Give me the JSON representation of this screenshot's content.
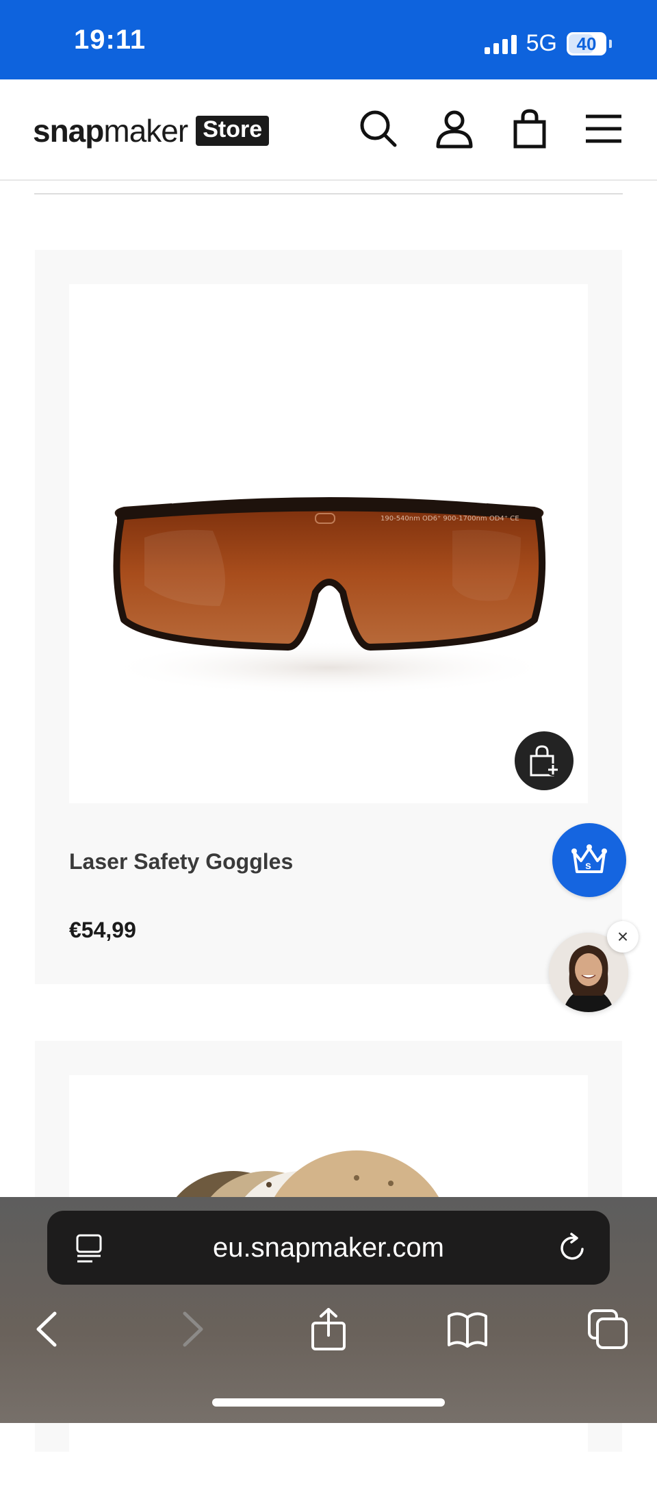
{
  "status_bar": {
    "time": "19:11",
    "network": "5G",
    "battery": "40",
    "icons": [
      "signal-icon",
      "battery-icon"
    ]
  },
  "header": {
    "logo_bold": "snap",
    "logo_light": "maker",
    "logo_store": "Store",
    "icons": [
      "search-icon",
      "account-icon",
      "cart-icon",
      "menu-icon"
    ]
  },
  "product": {
    "title": "Laser Safety Goggles",
    "price": "€54,99",
    "lens_print": "190-540nm OD6⁺ 900-1700nm OD4⁺ CE",
    "quick_add_icon": "add-to-cart-icon"
  },
  "floating": {
    "loyalty_icon": "crown-icon",
    "close_label": "×"
  },
  "safari": {
    "url": "eu.snapmaker.com",
    "icons": [
      "page-menu-icon",
      "reload-icon",
      "back-icon",
      "forward-icon",
      "share-icon",
      "bookmarks-icon",
      "tabs-icon"
    ]
  },
  "colors": {
    "status_bar": "#0e63dd",
    "accent": "#1565e0",
    "card_bg": "#f8f8f8",
    "lens": "#9a3f12"
  }
}
